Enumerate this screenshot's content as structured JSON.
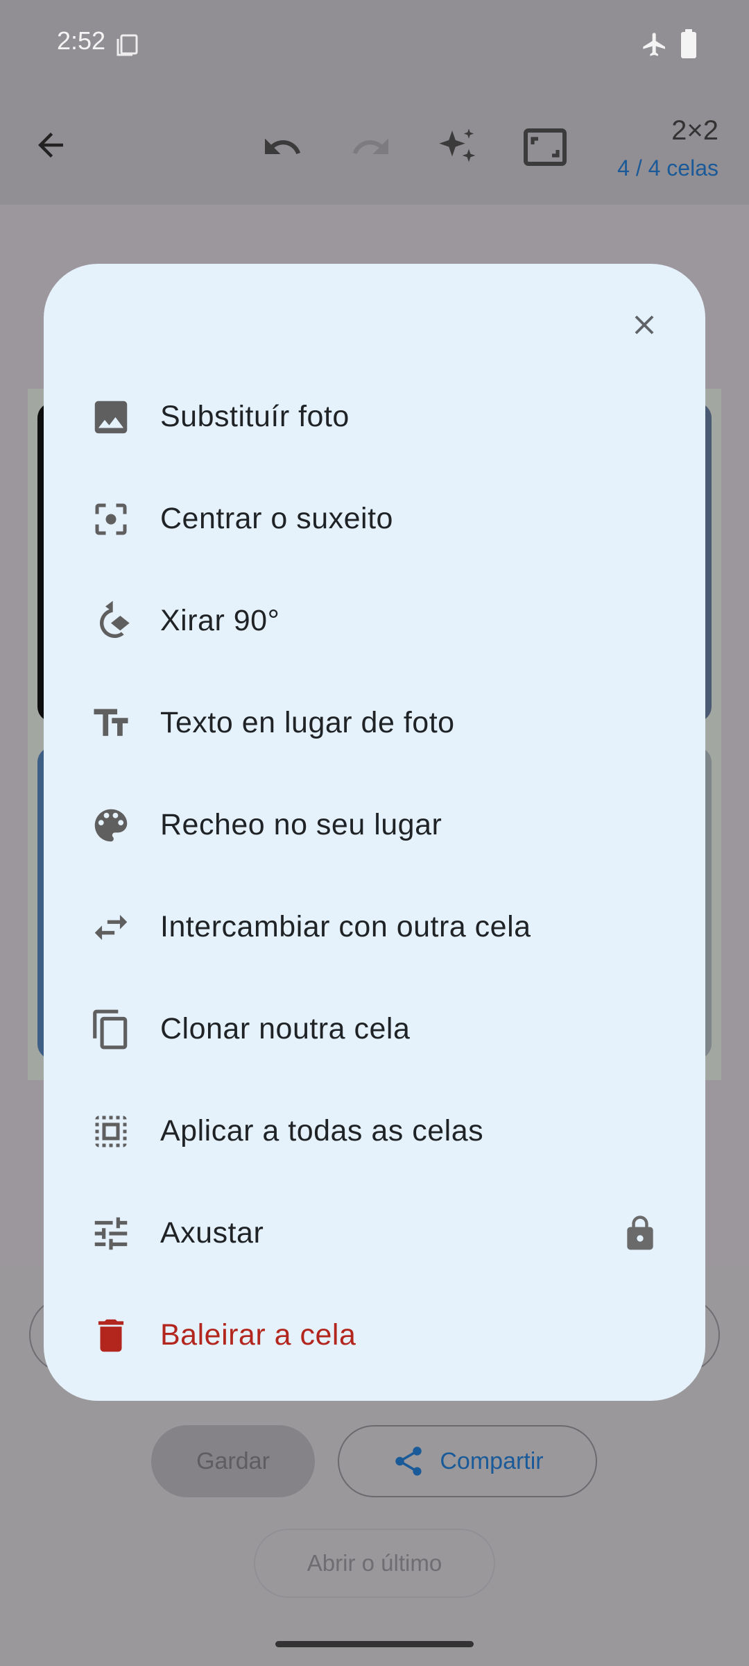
{
  "status_bar": {
    "time": "2:52"
  },
  "toolbar": {
    "grid_size": "2×2",
    "cells_count": "4 / 4 celas"
  },
  "bottom": {
    "save_label": "Gardar",
    "share_label": "Compartir",
    "open_last_label": "Abrir o último"
  },
  "menu": {
    "items": [
      {
        "label": "Substituír foto",
        "icon": "image-icon"
      },
      {
        "label": "Centrar o suxeito",
        "icon": "center-focus-icon"
      },
      {
        "label": "Xirar 90°",
        "icon": "rotate-icon"
      },
      {
        "label": "Texto en lugar de foto",
        "icon": "text-fields-icon"
      },
      {
        "label": "Recheo no seu lugar",
        "icon": "palette-icon"
      },
      {
        "label": "Intercambiar con outra cela",
        "icon": "swap-icon"
      },
      {
        "label": "Clonar noutra cela",
        "icon": "copy-icon"
      },
      {
        "label": "Aplicar a todas as celas",
        "icon": "select-all-icon"
      },
      {
        "label": "Axustar",
        "icon": "tune-icon",
        "locked": true
      },
      {
        "label": "Baleirar a cela",
        "icon": "trash-icon",
        "danger": true
      }
    ]
  },
  "colors": {
    "accent": "#1a63a8",
    "danger": "#b3261e",
    "dialog_bg": "#e5f1fb",
    "icon": "#6a6a6a"
  }
}
